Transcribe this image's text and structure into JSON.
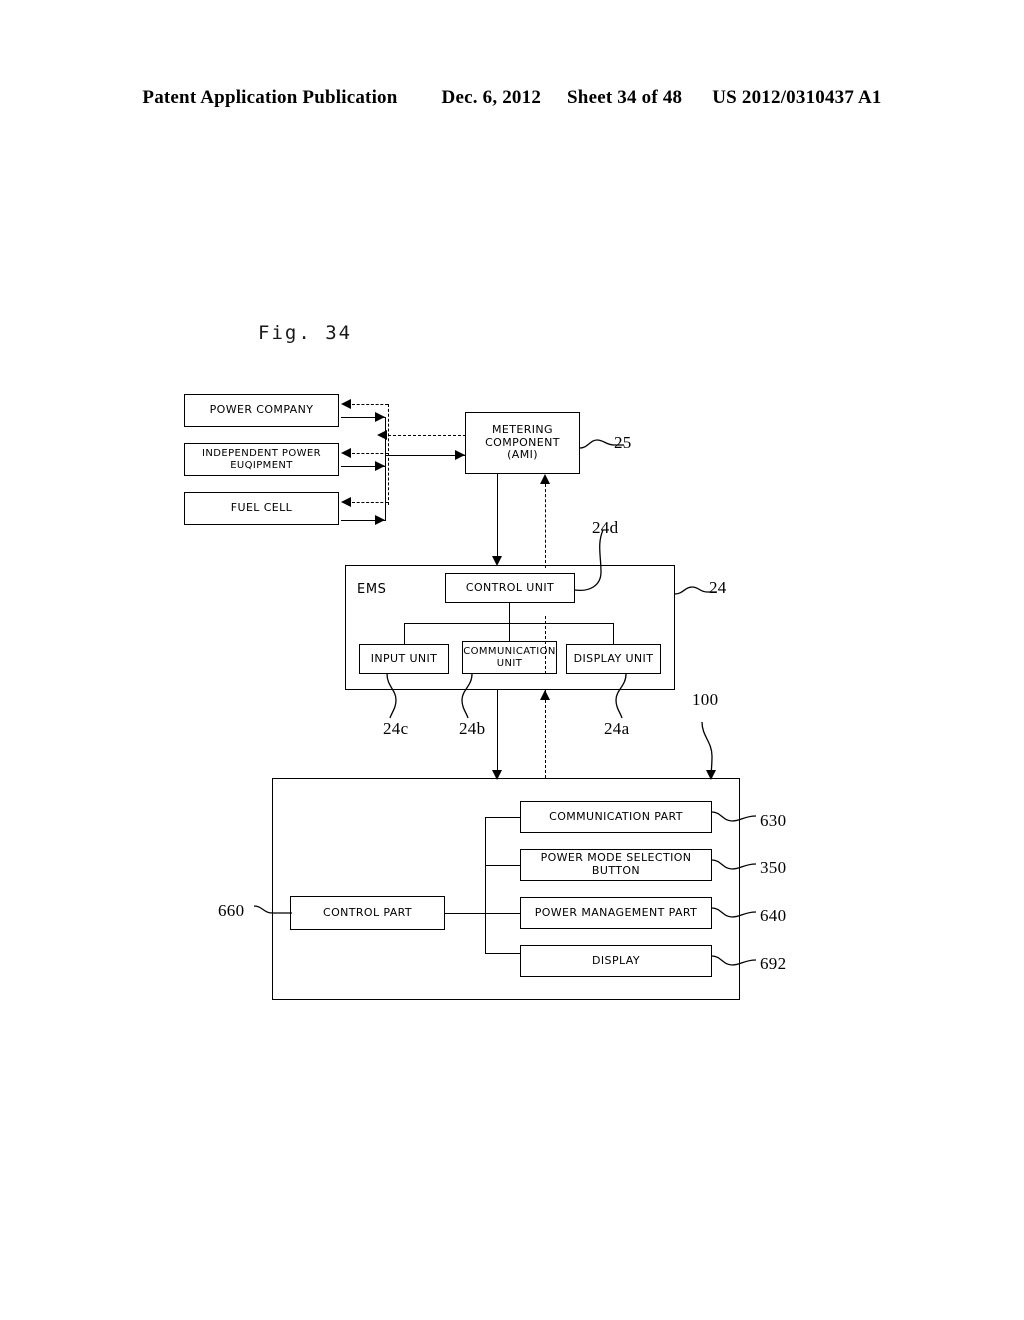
{
  "header": {
    "publication": "Patent Application Publication",
    "date": "Dec. 6, 2012",
    "sheet": "Sheet 34 of 48",
    "doc_number": "US 2012/0310437 A1"
  },
  "figure": {
    "label": "Fig. 34"
  },
  "sources": [
    {
      "label": "POWER COMPANY"
    },
    {
      "label": "INDEPENDENT POWER EUQIPMENT"
    },
    {
      "label": "FUEL CELL"
    }
  ],
  "metering": {
    "line1": "METERING COMPONENT",
    "line2": "(AMI)",
    "ref": "25"
  },
  "ems": {
    "tag": "EMS",
    "ref": "24",
    "control_unit": {
      "label": "CONTROL UNIT",
      "ref": "24d"
    },
    "input_unit": {
      "label": "INPUT UNIT",
      "ref": "24c"
    },
    "communication_unit": {
      "line1": "COMMUNICATION",
      "line2": "UNIT",
      "ref": "24b"
    },
    "display_unit": {
      "label": "DISPLAY UNIT",
      "ref": "24a"
    }
  },
  "appliance": {
    "ref": "100",
    "control_part": {
      "label": "CONTROL PART",
      "ref": "660"
    },
    "modules": [
      {
        "label": "COMMUNICATION PART",
        "ref": "630"
      },
      {
        "label": "POWER MODE SELECTION BUTTON",
        "ref": "350"
      },
      {
        "label": "POWER MANAGEMENT PART",
        "ref": "640"
      },
      {
        "label": "DISPLAY",
        "ref": "692"
      }
    ]
  },
  "colors": {
    "ink": "#000000",
    "paper": "#ffffff"
  }
}
